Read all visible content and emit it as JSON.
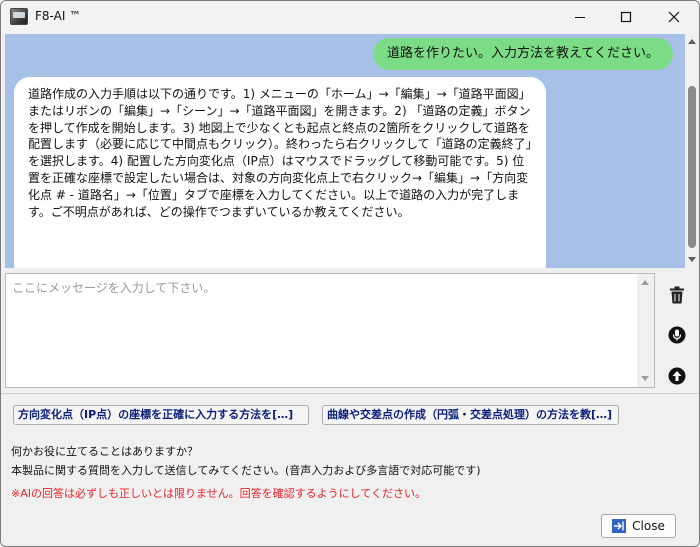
{
  "window": {
    "title": "F8-AI ™"
  },
  "chat": {
    "user_message": "道路を作りたい。入力方法を教えてください。",
    "ai_message": "道路作成の入力手順は以下の通りです。1) メニューの「ホーム」→「編集」→「道路平面図」またはリボンの「編集」→「シーン」→「道路平面図」を開きます。2) 「道路の定義」ボタンを押して作成を開始します。3) 地図上で少なくとも起点と終点の2箇所をクリックして道路を配置します（必要に応じて中間点もクリック）。終わったら右クリックして「道路の定義終了」を選択します。4) 配置した方向変化点（IP点）はマウスでドラッグして移動可能です。5) 位置を正確な座標で設定したい場合は、対象の方向変化点上で右クリック→「編集」→「方向変化点 # - 道路名」→「位置」タブで座標を入力してください。以上で道路の入力が完了します。ご不明点があれば、どの操作でつまずいているか教えてください。"
  },
  "input": {
    "placeholder": "ここにメッセージを入力して下さい。",
    "value": ""
  },
  "suggestions": [
    "方向変化点（IP点）の座標を正確に入力する方法を[…]",
    "曲線や交差点の作成（円弧・交差点処理）の方法を教[…]"
  ],
  "help": {
    "line1": "何かお役に立てることはありますか？",
    "line2": "本製品に関する質問を入力して送信してみてください。(音声入力および多言語で対応可能です)",
    "warning": "※AIの回答は必ずしも正しいとは限りません。回答を確認するようにしてください。"
  },
  "footer": {
    "close_label": "Close"
  },
  "colors": {
    "chat_bg": "#a7c0e7",
    "user_bubble": "#7cdc86",
    "ai_bubble": "#ffffff",
    "warning": "#e8242a",
    "suggestion_text": "#0b1f7a"
  },
  "icons": {
    "app": "app-icon",
    "minimize": "minimize-icon",
    "maximize": "maximize-icon",
    "close": "close-icon",
    "trash": "trash-icon",
    "mic": "microphone-icon",
    "send": "send-arrow-up-icon",
    "exit": "exit-icon"
  }
}
